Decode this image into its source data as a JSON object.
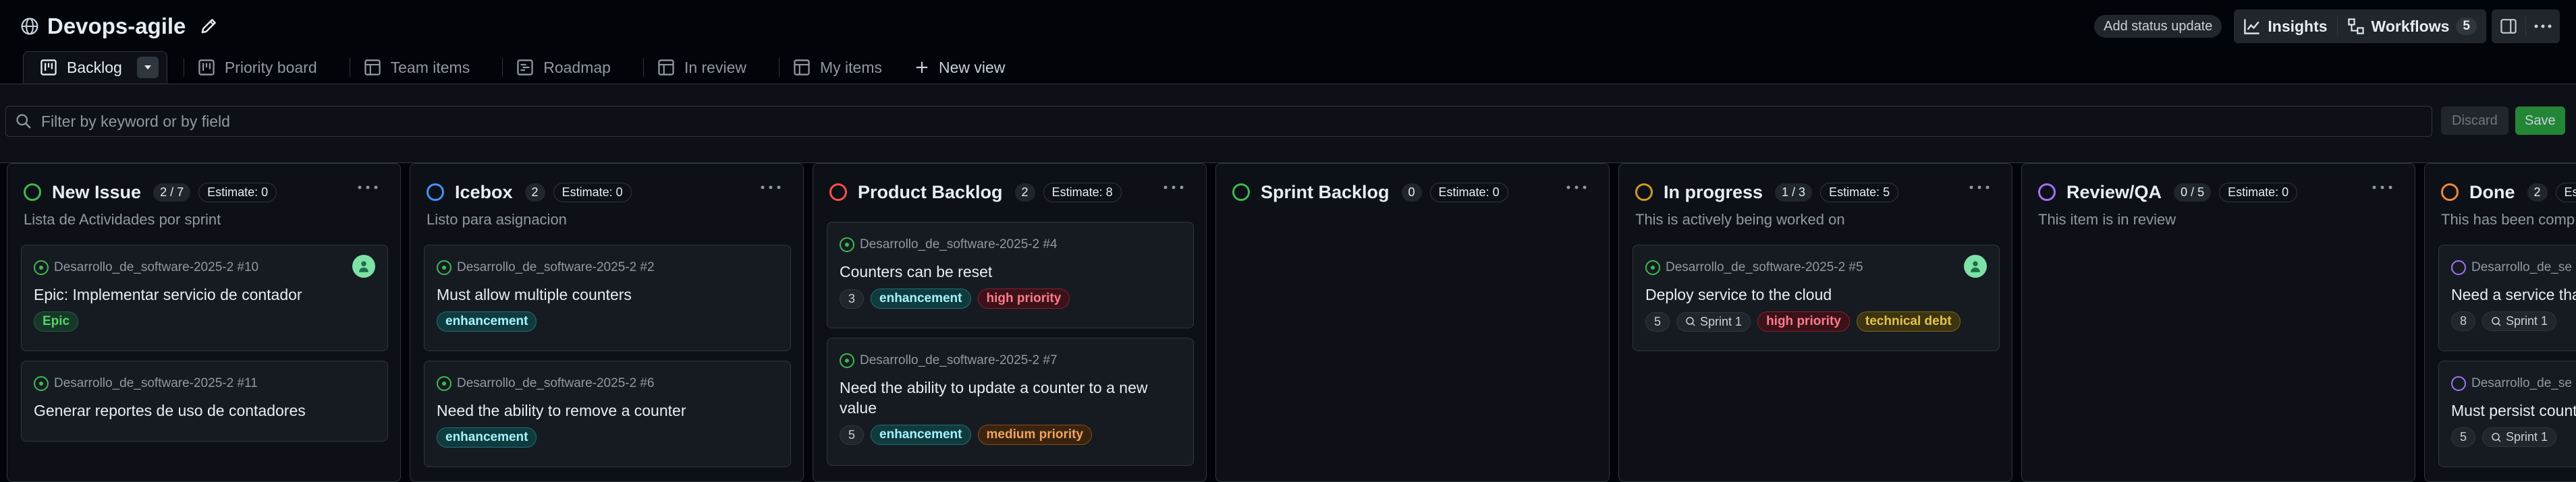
{
  "project": {
    "title": "Devops-agile"
  },
  "header": {
    "add_status_update": "Add status update",
    "insights": "Insights",
    "workflows": "Workflows",
    "workflows_count": "5"
  },
  "tabs": [
    {
      "label": "Backlog",
      "active": true,
      "icon": "board-icon"
    },
    {
      "label": "Priority board",
      "icon": "board-icon"
    },
    {
      "label": "Team items",
      "icon": "table-icon"
    },
    {
      "label": "Roadmap",
      "icon": "roadmap-icon"
    },
    {
      "label": "In review",
      "icon": "table-icon"
    },
    {
      "label": "My items",
      "icon": "table-icon"
    }
  ],
  "new_view": "New view",
  "filter": {
    "placeholder": "Filter by keyword or by field",
    "value": ""
  },
  "actions": {
    "discard": "Discard",
    "save": "Save"
  },
  "columns": [
    {
      "name": "New Issue",
      "count": "2 / 7",
      "estimate": "Estimate: 0",
      "color": "#3fb950",
      "description": "Lista de Actividades por sprint",
      "cards": [
        {
          "repo": "Desarrollo_de_software-2025-2 #10",
          "title": "Epic: Implementar servicio de contador",
          "labels": [
            "Epic"
          ],
          "has_avatar": true
        },
        {
          "repo": "Desarrollo_de_software-2025-2 #11",
          "title": "Generar reportes de uso de contadores"
        }
      ]
    },
    {
      "name": "Icebox",
      "count": "2",
      "estimate": "Estimate: 0",
      "color": "#4493f8",
      "description": "Listo para asignacion",
      "cards": [
        {
          "repo": "Desarrollo_de_software-2025-2 #2",
          "title": "Must allow multiple counters",
          "labels": [
            "enhancement"
          ]
        },
        {
          "repo": "Desarrollo_de_software-2025-2 #6",
          "title": "Need the ability to remove a counter",
          "labels": [
            "enhancement"
          ]
        }
      ]
    },
    {
      "name": "Product Backlog",
      "count": "2",
      "estimate": "Estimate: 8",
      "color": "#f85149",
      "description": "",
      "cards": [
        {
          "repo": "Desarrollo_de_software-2025-2 #4",
          "title": "Counters can be reset",
          "estimate": "3",
          "labels": [
            "enhancement",
            "high priority"
          ]
        },
        {
          "repo": "Desarrollo_de_software-2025-2 #7",
          "title": "Need the ability to update a counter to a new value",
          "estimate": "5",
          "labels": [
            "enhancement",
            "medium priority"
          ]
        }
      ]
    },
    {
      "name": "Sprint Backlog",
      "count": "0",
      "estimate": "Estimate: 0",
      "color": "#3fb950",
      "description": "",
      "cards": []
    },
    {
      "name": "In progress",
      "count": "1 / 3",
      "estimate": "Estimate: 5",
      "color": "#d29922",
      "description": "This is actively being worked on",
      "cards": [
        {
          "repo": "Desarrollo_de_software-2025-2 #5",
          "title": "Deploy service to the cloud",
          "estimate": "5",
          "sprint": "Sprint 1",
          "labels": [
            "high priority",
            "technical debt"
          ],
          "has_avatar": true
        }
      ]
    },
    {
      "name": "Review/QA",
      "count": "0 / 5",
      "estimate": "Estimate: 0",
      "color": "#a371f7",
      "description": "This item is in review",
      "cards": []
    },
    {
      "name": "Done",
      "count": "2",
      "estimate": "Est",
      "color": "#f0883e",
      "description": "This has been comp",
      "cards": [
        {
          "repo": "Desarrollo_de_se",
          "title": "Need a service that",
          "estimate": "8",
          "sprint": "Sprint 1"
        },
        {
          "repo": "Desarrollo_de_se",
          "title": "Must persist count",
          "estimate": "5",
          "sprint": "Sprint 1"
        }
      ]
    }
  ]
}
